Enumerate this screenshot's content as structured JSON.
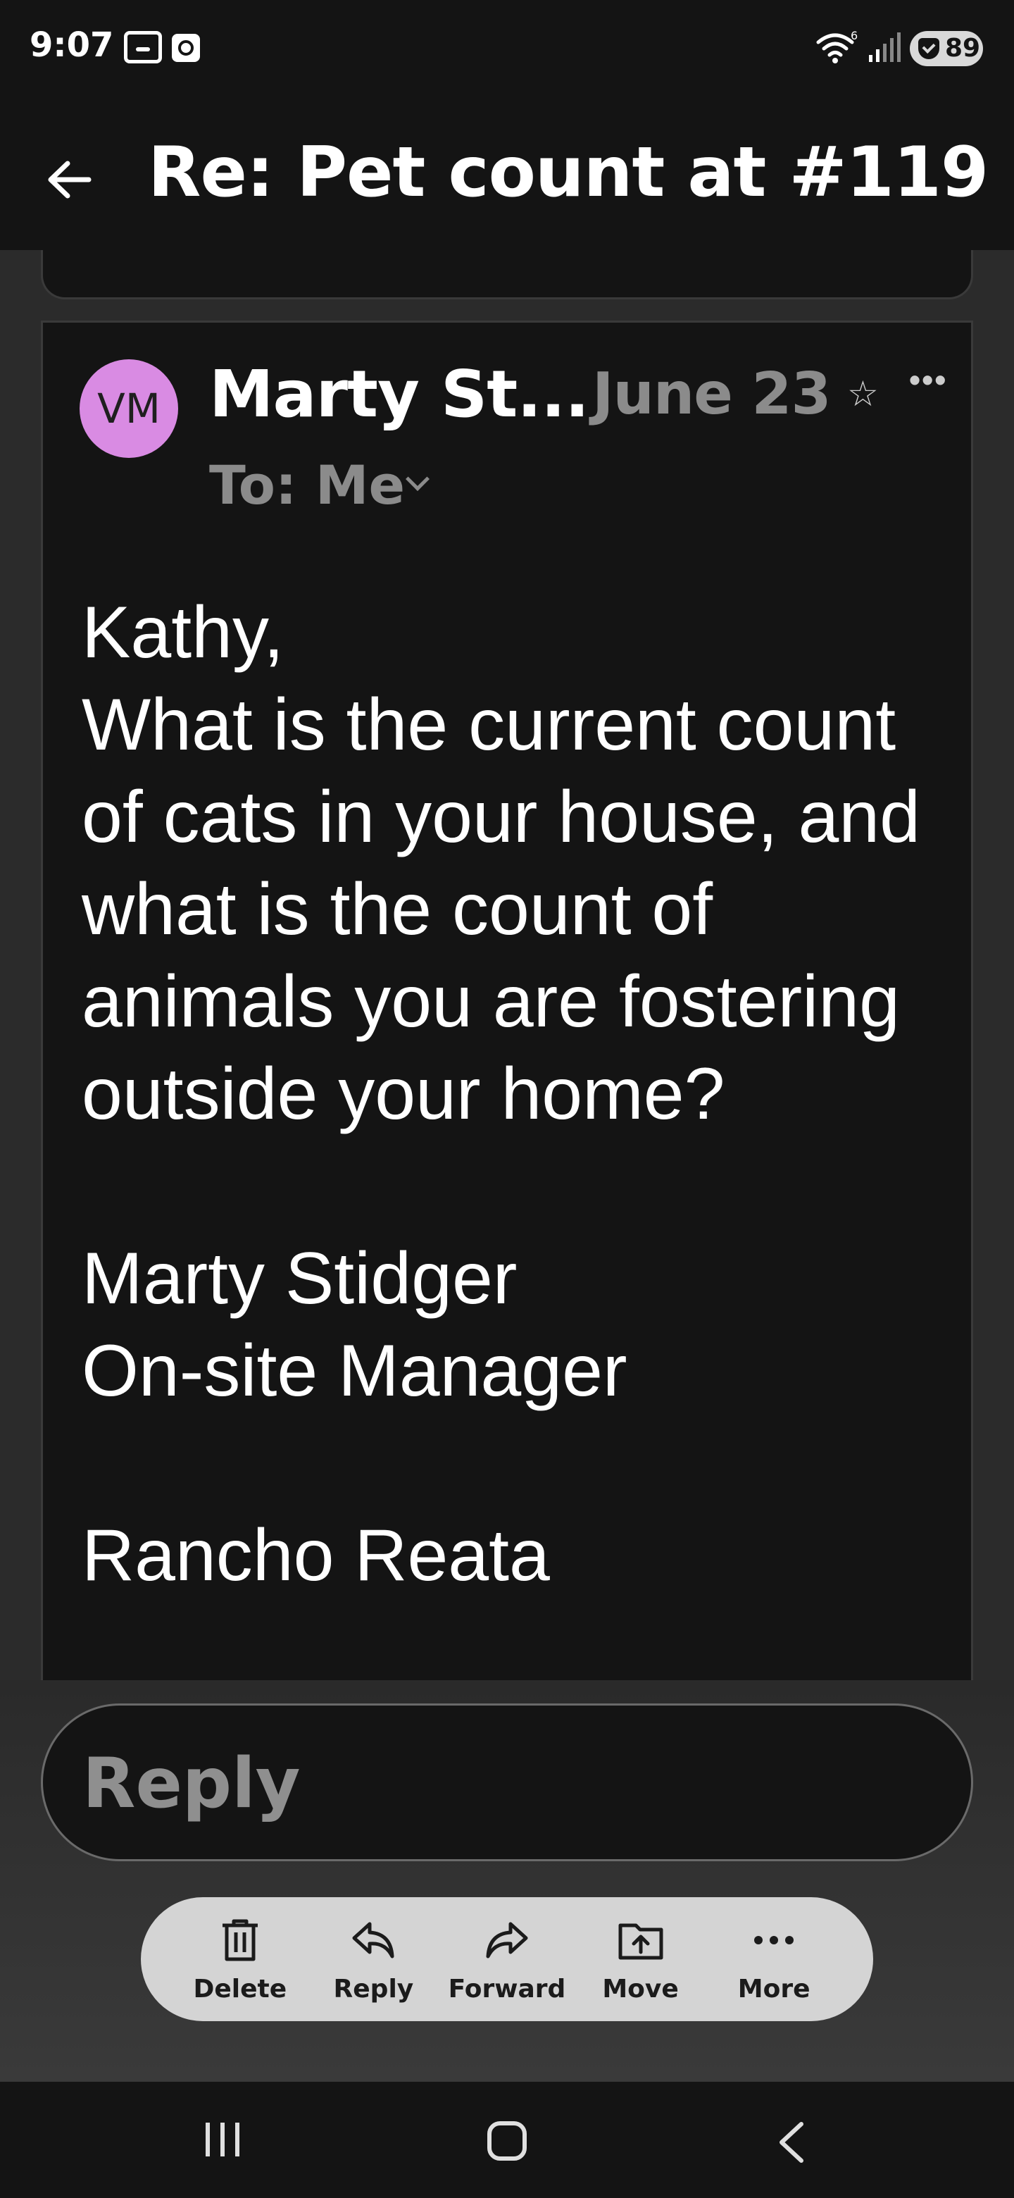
{
  "status_bar": {
    "time": "9:07",
    "wifi_superscript": "6",
    "battery": "89"
  },
  "header": {
    "title": "Re: Pet count at #119"
  },
  "message": {
    "avatar_initials": "VM",
    "avatar_color": "#d98be3",
    "sender": "Marty St...",
    "date": "June 23",
    "to": "To: Me",
    "body": "Kathy,\nWhat is the current count of cats in your house, and what is the count of animals you are fostering outside your home?\n\nMarty Stidger\nOn-site Manager\n\nRancho Reata"
  },
  "reply": {
    "placeholder": "Reply"
  },
  "actions": [
    {
      "label": "Delete",
      "icon": "trash-icon"
    },
    {
      "label": "Reply",
      "icon": "reply-icon"
    },
    {
      "label": "Forward",
      "icon": "forward-icon"
    },
    {
      "label": "Move",
      "icon": "move-icon"
    },
    {
      "label": "More",
      "icon": "more-icon"
    }
  ]
}
